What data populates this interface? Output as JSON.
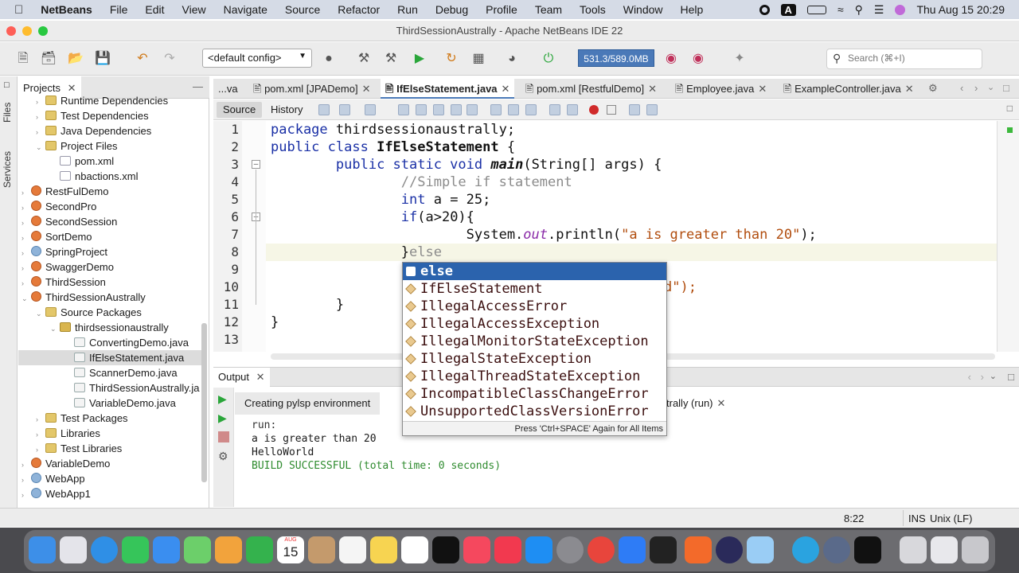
{
  "menubar": {
    "app_name": "NetBeans",
    "items": [
      "File",
      "Edit",
      "View",
      "Navigate",
      "Source",
      "Refactor",
      "Run",
      "Debug",
      "Profile",
      "Team",
      "Tools",
      "Window",
      "Help"
    ],
    "clock": "Thu Aug 15  20:29",
    "input_badge": "A"
  },
  "window": {
    "title": "ThirdSessionAustrally - Apache NetBeans IDE 22"
  },
  "toolbar": {
    "config": "<default config>",
    "memory": "531.3/589.0MB",
    "search_placeholder": "Search (⌘+I)"
  },
  "rail": {
    "files_label": "Files",
    "services_label": "Services"
  },
  "projects": {
    "tab_label": "Projects",
    "rows": [
      {
        "label": "Runtime Dependencies",
        "indent": 1,
        "icon": "fold",
        "tw": "›"
      },
      {
        "label": "Test Dependencies",
        "indent": 1,
        "icon": "fold",
        "tw": "›"
      },
      {
        "label": "Java Dependencies",
        "indent": 1,
        "icon": "fold",
        "tw": "›"
      },
      {
        "label": "Project Files",
        "indent": 1,
        "icon": "fold",
        "tw": "⌄"
      },
      {
        "label": "pom.xml",
        "indent": 2,
        "icon": "xfile",
        "tw": ""
      },
      {
        "label": "nbactions.xml",
        "indent": 2,
        "icon": "xfile",
        "tw": ""
      },
      {
        "label": "RestFulDemo",
        "indent": 0,
        "icon": "cup",
        "tw": "›"
      },
      {
        "label": "SecondPro",
        "indent": 0,
        "icon": "cup",
        "tw": "›"
      },
      {
        "label": "SecondSession",
        "indent": 0,
        "icon": "cup",
        "tw": "›"
      },
      {
        "label": "SortDemo",
        "indent": 0,
        "icon": "cup",
        "tw": "›"
      },
      {
        "label": "SpringProject",
        "indent": 0,
        "icon": "globe",
        "tw": "›"
      },
      {
        "label": "SwaggerDemo",
        "indent": 0,
        "icon": "cup",
        "tw": "›"
      },
      {
        "label": "ThirdSession",
        "indent": 0,
        "icon": "cup",
        "tw": "›"
      },
      {
        "label": "ThirdSessionAustrally",
        "indent": 0,
        "icon": "cup",
        "tw": "⌄"
      },
      {
        "label": "Source Packages",
        "indent": 1,
        "icon": "fold",
        "tw": "⌄"
      },
      {
        "label": "thirdsessionaustrally",
        "indent": 2,
        "icon": "pkg",
        "tw": "⌄"
      },
      {
        "label": "ConvertingDemo.java",
        "indent": 3,
        "icon": "jfile",
        "tw": ""
      },
      {
        "label": "IfElseStatement.java",
        "indent": 3,
        "icon": "jfile",
        "tw": "",
        "selected": true
      },
      {
        "label": "ScannerDemo.java",
        "indent": 3,
        "icon": "jfile",
        "tw": ""
      },
      {
        "label": "ThirdSessionAustrally.ja",
        "indent": 3,
        "icon": "jfile",
        "tw": ""
      },
      {
        "label": "VariableDemo.java",
        "indent": 3,
        "icon": "jfile",
        "tw": ""
      },
      {
        "label": "Test Packages",
        "indent": 1,
        "icon": "fold",
        "tw": "›"
      },
      {
        "label": "Libraries",
        "indent": 1,
        "icon": "fold",
        "tw": "›"
      },
      {
        "label": "Test Libraries",
        "indent": 1,
        "icon": "fold",
        "tw": "›"
      },
      {
        "label": "VariableDemo",
        "indent": 0,
        "icon": "cup",
        "tw": "›"
      },
      {
        "label": "WebApp",
        "indent": 0,
        "icon": "globe",
        "tw": "›"
      },
      {
        "label": "WebApp1",
        "indent": 0,
        "icon": "globe",
        "tw": "›"
      }
    ]
  },
  "editor": {
    "tabs": [
      {
        "label": "...va",
        "active": false
      },
      {
        "label": "pom.xml [JPADemo]",
        "active": false
      },
      {
        "label": "IfElseStatement.java",
        "active": true
      },
      {
        "label": "pom.xml [RestfulDemo]",
        "active": false
      },
      {
        "label": "Employee.java",
        "active": false
      },
      {
        "label": "ExampleController.java",
        "active": false
      }
    ],
    "source_label": "Source",
    "history_label": "History",
    "line_numbers": [
      "1",
      "2",
      "3",
      "4",
      "5",
      "6",
      "7",
      "8",
      "9",
      "10",
      "11",
      "12",
      "13"
    ]
  },
  "code": {
    "l1_kw": "package",
    "l1_rest": " thirdsessionaustrally;",
    "l2_kw": "public class",
    "l2_name": "IfElseStatement",
    "l2_rest": " {",
    "l3_kw": "public static void",
    "l3_name": "main",
    "l3_rest": "(String[] args) {",
    "l4_comment": "//Simple if statement",
    "l5_kw": "int",
    "l5_rest": " a = 25;",
    "l6_kw": "if",
    "l6_rest": "(a>20){",
    "l7_a": "System.",
    "l7_out": "out",
    "l7_b": ".println(",
    "l7_str": "\"a is greater than 20\"",
    "l7_c": ");",
    "l8_a": "}",
    "l8_typed": "else",
    "l10_tail": "d\");",
    "l11": "}",
    "l12": "}"
  },
  "completion": {
    "items": [
      "else",
      "IfElseStatement",
      "IllegalAccessError",
      "IllegalAccessException",
      "IllegalMonitorStateException",
      "IllegalStateException",
      "IllegalThreadStateException",
      "IncompatibleClassChangeError",
      "UnsupportedClassVersionError"
    ],
    "footer": "Press 'Ctrl+SPACE' Again for All Items"
  },
  "output": {
    "tab_label": "Output",
    "sub_tabs": [
      "Creating pylsp environment",
      "trally (run)"
    ],
    "lines": [
      "run:",
      "a is greater than 20",
      "HelloWorld",
      "BUILD SUCCESSFUL (total time: 0 seconds)"
    ],
    "success_color": "#2e8b2e"
  },
  "status": {
    "position": "8:22",
    "mode": "INS",
    "line_endings": "Unix (LF)"
  },
  "dock": {
    "calendar_month": "AUG",
    "calendar_day": "15"
  }
}
